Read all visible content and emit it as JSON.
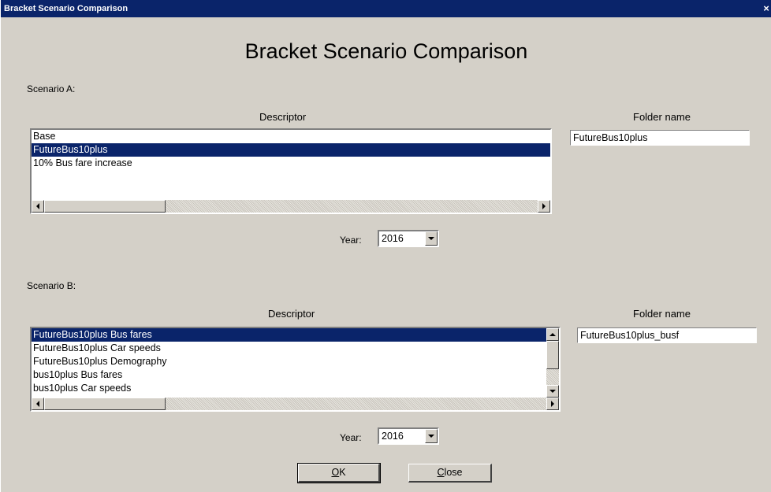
{
  "window": {
    "title": "Bracket Scenario Comparison",
    "close_glyph": "×"
  },
  "heading": "Bracket Scenario Comparison",
  "scenario_a": {
    "label": "Scenario A:",
    "descriptor_header": "Descriptor",
    "folder_header": "Folder name",
    "items": [
      "Base",
      "FutureBus10plus",
      "10% Bus fare increase"
    ],
    "selected_index": 1,
    "folder_value": "FutureBus10plus",
    "year_label": "Year:",
    "year_value": "2016"
  },
  "scenario_b": {
    "label": "Scenario B:",
    "descriptor_header": "Descriptor",
    "folder_header": "Folder name",
    "items": [
      "FutureBus10plus Bus fares",
      "FutureBus10plus Car speeds",
      "FutureBus10plus Demography",
      "bus10plus Bus fares",
      "bus10plus Car speeds"
    ],
    "selected_index": 0,
    "folder_value": "FutureBus10plus_busf",
    "year_label": "Year:",
    "year_value": "2016"
  },
  "buttons": {
    "ok_mnemonic": "O",
    "ok_rest": "K",
    "close_mnemonic": "C",
    "close_rest": "lose"
  },
  "colors": {
    "titlebar": "#0a246a",
    "dialog_bg": "#d4d0c8",
    "selection": "#0a246a"
  }
}
